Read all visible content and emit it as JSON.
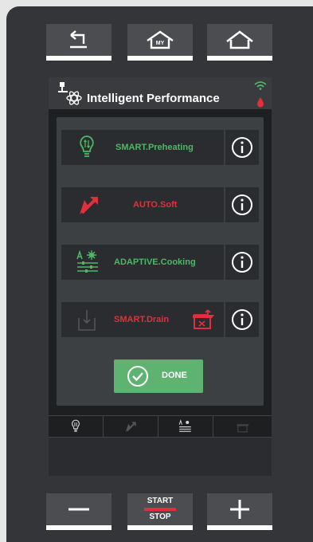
{
  "header": {
    "title": "Intelligent Performance"
  },
  "functions": [
    {
      "label": "SMART.Preheating",
      "color": "#4cb866",
      "icon": "bulb-arrows-icon"
    },
    {
      "label": "AUTO.Soft",
      "color": "#e0303e",
      "icon": "soft-arrow-icon"
    },
    {
      "label": "ADAPTIVE.Cooking",
      "color": "#4cb866",
      "icon": "adaptive-sliders-icon"
    },
    {
      "label": "SMART.Drain",
      "color": "#e0303e",
      "icon": "drain-icon"
    }
  ],
  "done_button": {
    "label": "DONE"
  },
  "start_stop": {
    "start": "START",
    "stop": "STOP"
  },
  "my_home_label": "MY",
  "colors": {
    "green": "#4cb866",
    "red": "#e0303e",
    "done_bg": "#5fb371",
    "wifi": "#4cb866"
  }
}
